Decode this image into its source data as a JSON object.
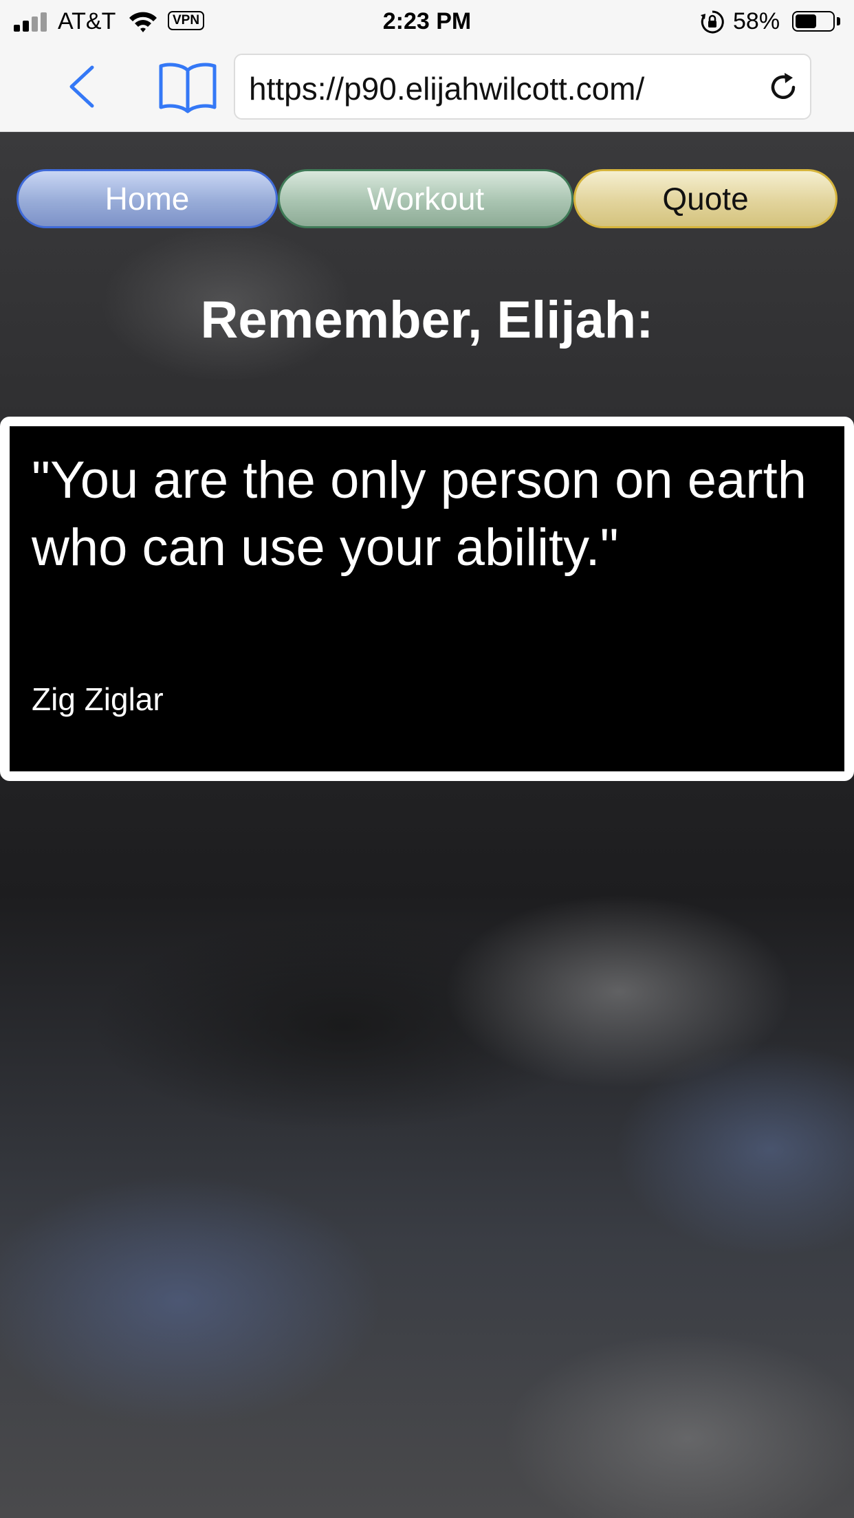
{
  "status_bar": {
    "carrier": "AT&T",
    "vpn_label": "VPN",
    "time": "2:23 PM",
    "battery_percent": "58%",
    "battery_level": 0.58,
    "icons": [
      "signal-icon",
      "wifi-icon",
      "rotation-lock-icon",
      "battery-icon"
    ]
  },
  "browser": {
    "url": "https://p90.elijahwilcott.com/",
    "icons": [
      "back-chevron-icon",
      "bookmarks-book-icon",
      "reload-icon"
    ]
  },
  "nav": {
    "home": "Home",
    "workout": "Workout",
    "quote": "Quote"
  },
  "colors": {
    "home": "#3f6ad8",
    "workout": "#3f7a57",
    "quote": "#d6b43c"
  },
  "page": {
    "heading": "Remember, Elijah:",
    "quote": {
      "text": "\"You are the only person on earth who can use your ability.\"",
      "author": "Zig Ziglar"
    }
  }
}
